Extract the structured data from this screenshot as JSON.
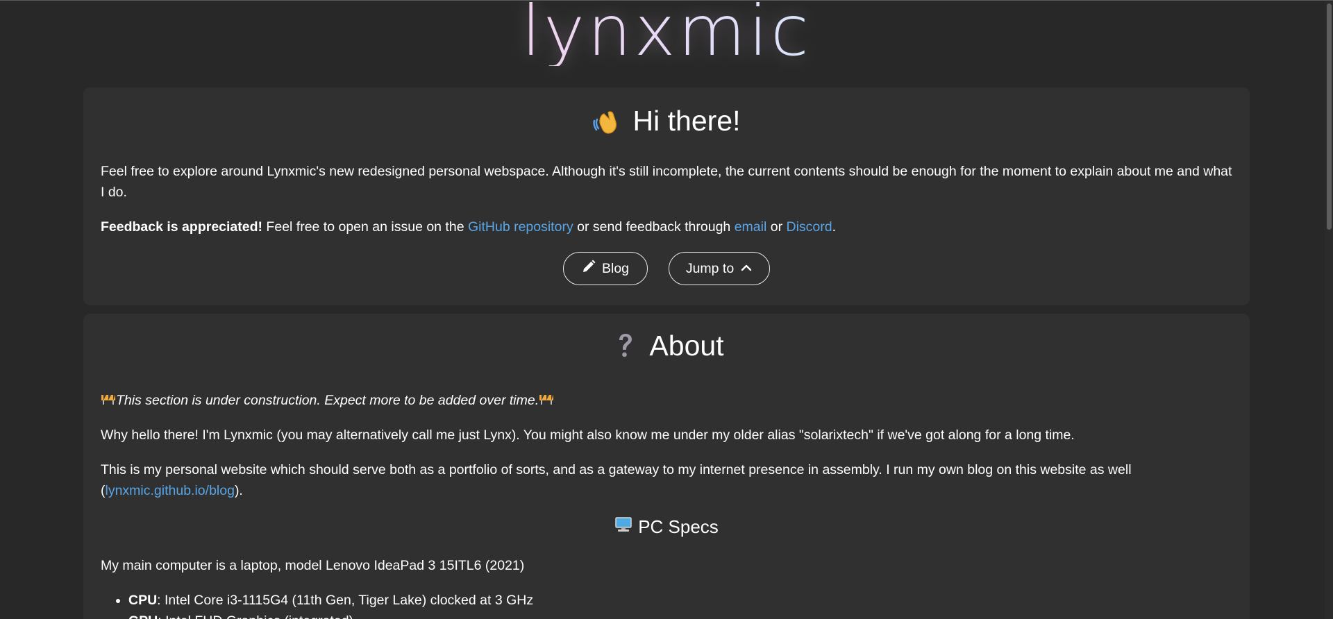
{
  "site": {
    "logo_text": "lynxmic"
  },
  "greeting": {
    "title": "Hi there!",
    "intro": "Feel free to explore around Lynxmic's new redesigned personal webspace. Although it's still incomplete, the current contents should be enough for the moment to explain about me and what I do.",
    "feedback_bold": "Feedback is appreciated!",
    "feedback_text_1": " Feel free to open an issue on the ",
    "github_link": "GitHub repository",
    "feedback_text_2": " or send feedback through ",
    "email_link": "email",
    "feedback_text_3": " or ",
    "discord_link": "Discord",
    "feedback_text_4": ".",
    "blog_button": "Blog",
    "jump_button": "Jump to"
  },
  "about": {
    "title": "About",
    "notice": "This section is under construction. Expect more to be added over time.",
    "para1": "Why hello there! I'm Lynxmic (you may alternatively call me just Lynx). You might also know me under my older alias \"solarixtech\" if we've got along for a long time.",
    "para2_text": "This is my personal website which should serve both as a portfolio of sorts, and as a gateway to my internet presence in assembly. I run my own blog on this website as well (",
    "para2_link": "lynxmic.github.io/blog",
    "para2_end": ").",
    "specs_title": "PC Specs",
    "specs_intro": "My main computer is a laptop, model Lenovo IdeaPad 3 15ITL6 (2021)",
    "specs": [
      {
        "label": "CPU",
        "value": ": Intel Core i3-1115G4 (11th Gen, Tiger Lake) clocked at 3 GHz"
      },
      {
        "label": "GPU",
        "value": ": Intel FHD Graphics (integrated)"
      }
    ]
  },
  "icons": {
    "wave": "waving-hand",
    "question": "question-mark",
    "construction": "construction-barrier",
    "computer": "desktop-computer",
    "pencil": "pencil",
    "chevron": "chevron-up"
  },
  "colors": {
    "background": "#282828",
    "card": "#303030",
    "link": "#58a6e8"
  }
}
